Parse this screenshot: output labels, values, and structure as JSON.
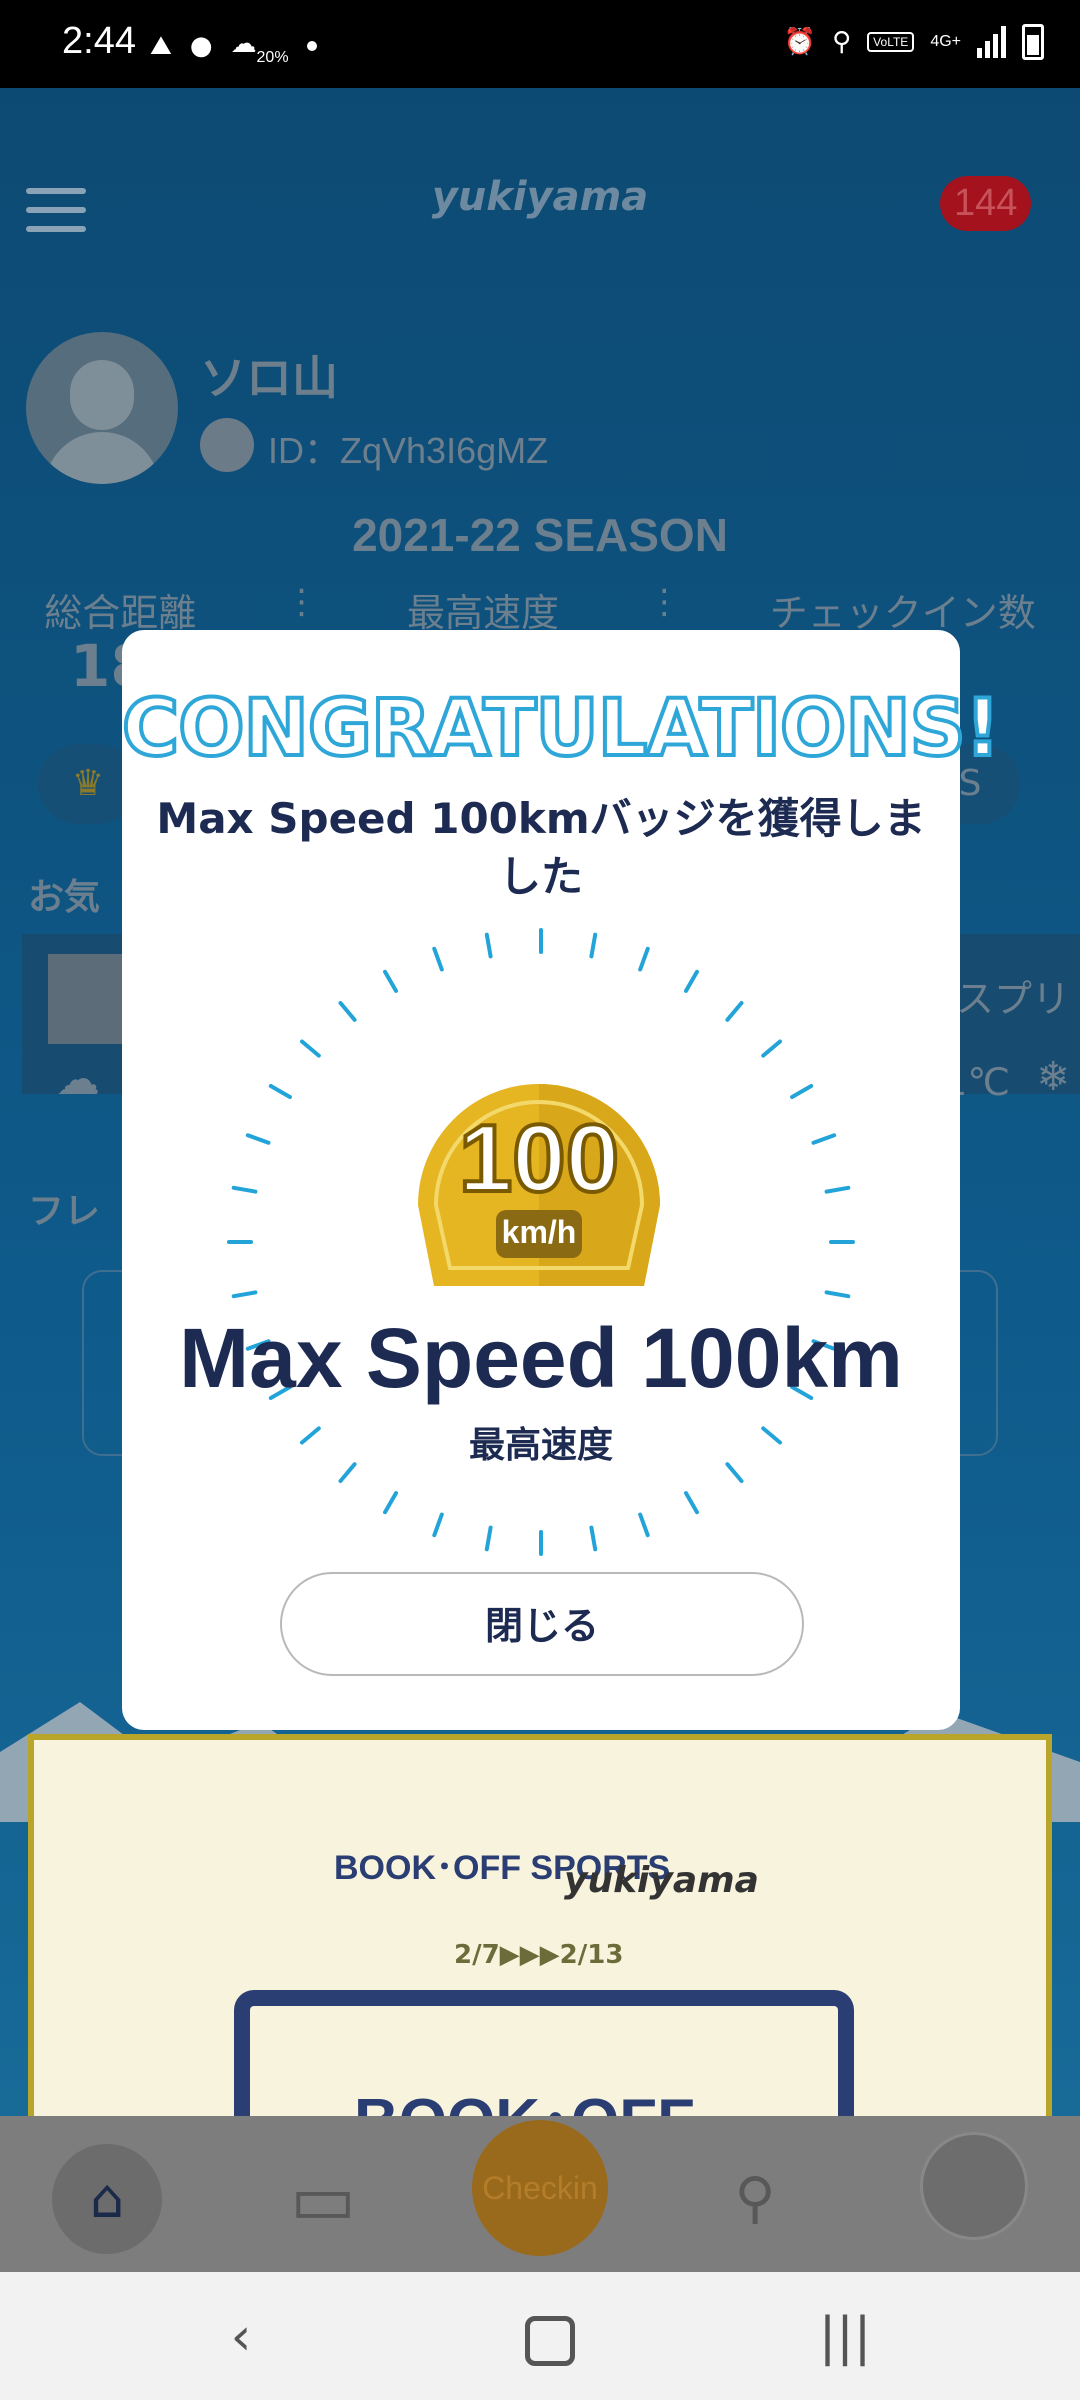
{
  "status_bar": {
    "time": "2:44",
    "weather_percent": "20%",
    "network": "4G+",
    "volte": "VoLTE"
  },
  "app": {
    "logo": "yukiyama",
    "notification_count": "144",
    "user_name": "ソロ山",
    "user_id": "ID：ZqVh3I6gMZ",
    "season": "2021-22 SEASON",
    "stats_labels": [
      "総合距離",
      "最高速度",
      "チェックイン数"
    ],
    "peek_total": "18",
    "peek_favorites": "お気",
    "peek_friends": "フレ",
    "peek_resort": "スプリ",
    "peek_temp": "1℃",
    "peek_pill": "S",
    "banner": {
      "brand1": "BOOK･OFF SPORTS",
      "brand2": "yukiyama",
      "dates": "2/7▶▶▶2/13",
      "main": "BOOK･OFF"
    }
  },
  "bottom_nav": {
    "checkin_label": "Checkin"
  },
  "modal": {
    "title": "CONGRATULATIONS!",
    "message": "Max Speed 100kmバッジを獲得しました",
    "badge_value": "100",
    "badge_unit": "km/h",
    "badge_name": "Max Speed 100km",
    "badge_category": "最高速度",
    "close_label": "閉じる"
  },
  "colors": {
    "accent_blue": "#2ea7d8",
    "navy_text": "#1d2b52",
    "badge_gold": "#e5b522"
  }
}
